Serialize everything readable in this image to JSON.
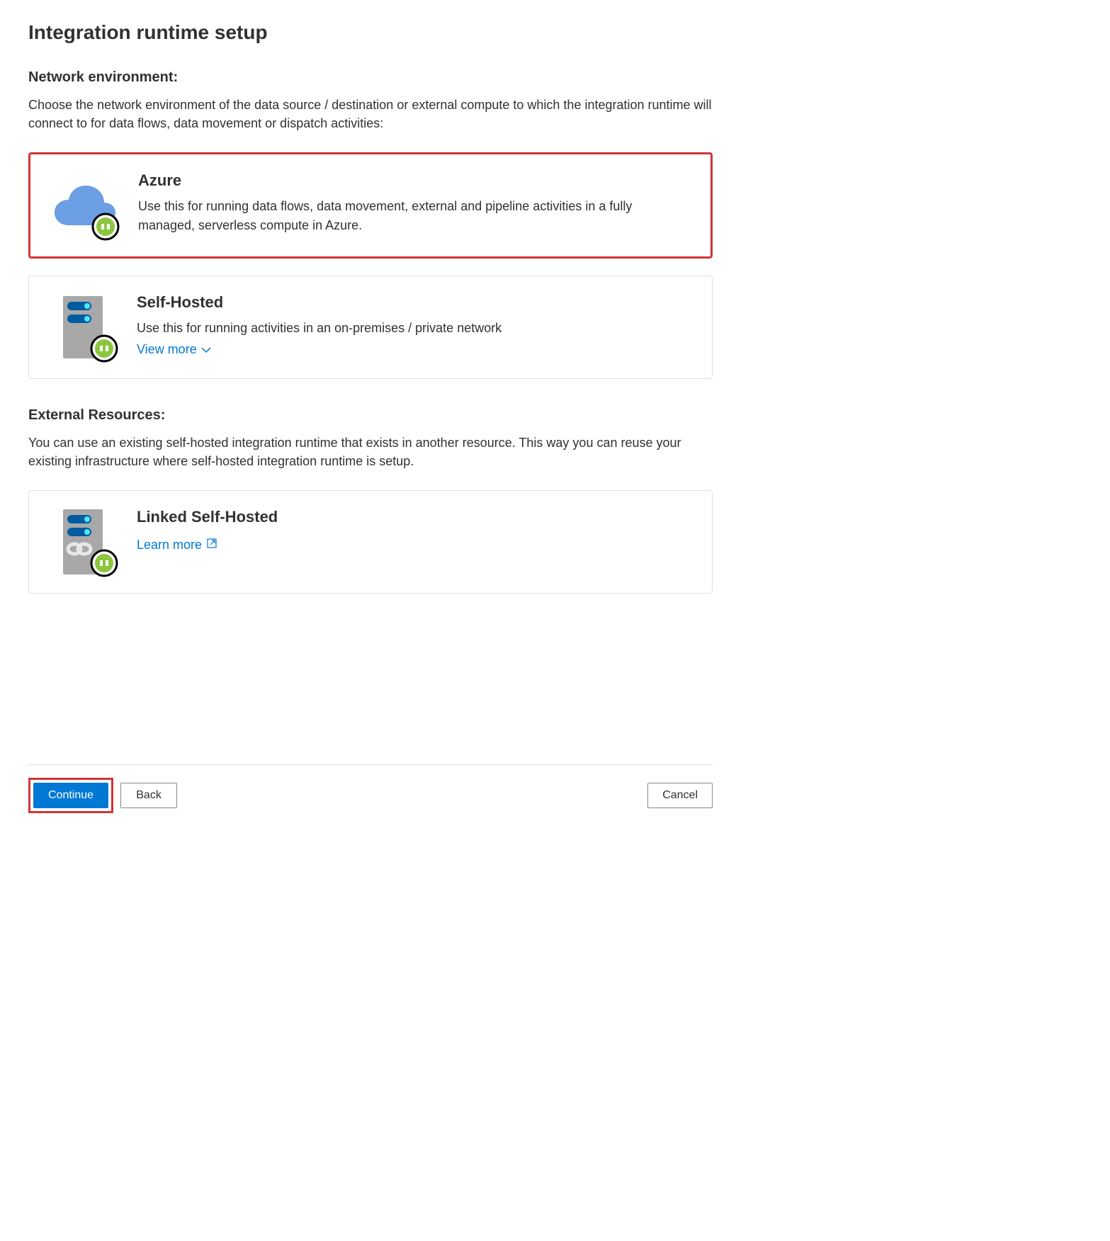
{
  "title": "Integration runtime setup",
  "networkSection": {
    "heading": "Network environment:",
    "description": "Choose the network environment of the data source / destination or external compute to which the integration runtime will connect to for data flows, data movement or dispatch activities:"
  },
  "options": {
    "azure": {
      "title": "Azure",
      "description": "Use this for running data flows, data movement, external and pipeline activities in a fully managed, serverless compute in Azure."
    },
    "selfHosted": {
      "title": "Self-Hosted",
      "description": "Use this for running activities in an on-premises / private network",
      "viewMore": "View more"
    }
  },
  "externalSection": {
    "heading": "External Resources:",
    "description": "You can use an existing self-hosted integration runtime that exists in another resource. This way you can reuse your existing infrastructure where self-hosted integration runtime is setup."
  },
  "linkedSelfHosted": {
    "title": "Linked Self-Hosted",
    "learnMore": "Learn more"
  },
  "buttons": {
    "continue": "Continue",
    "back": "Back",
    "cancel": "Cancel"
  }
}
